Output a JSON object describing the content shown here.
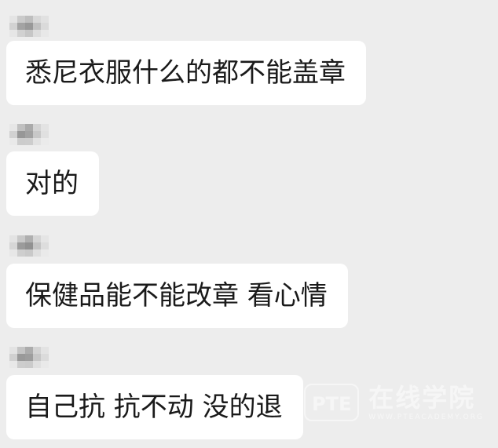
{
  "chat": {
    "messages": [
      {
        "text": "悉尼衣服什么的都不能盖章"
      },
      {
        "text": "对的"
      },
      {
        "text": "保健品能不能改章 看心情"
      },
      {
        "text": "自己抗 抗不动 没的退"
      }
    ]
  },
  "watermark": {
    "logo_text": "PTE",
    "brand_text": "在线学院",
    "sub_text": "WWW.PTEACADEMY.ORG"
  },
  "colors": {
    "background": "#ededed",
    "bubble": "#ffffff",
    "text": "#1a1a1a"
  }
}
